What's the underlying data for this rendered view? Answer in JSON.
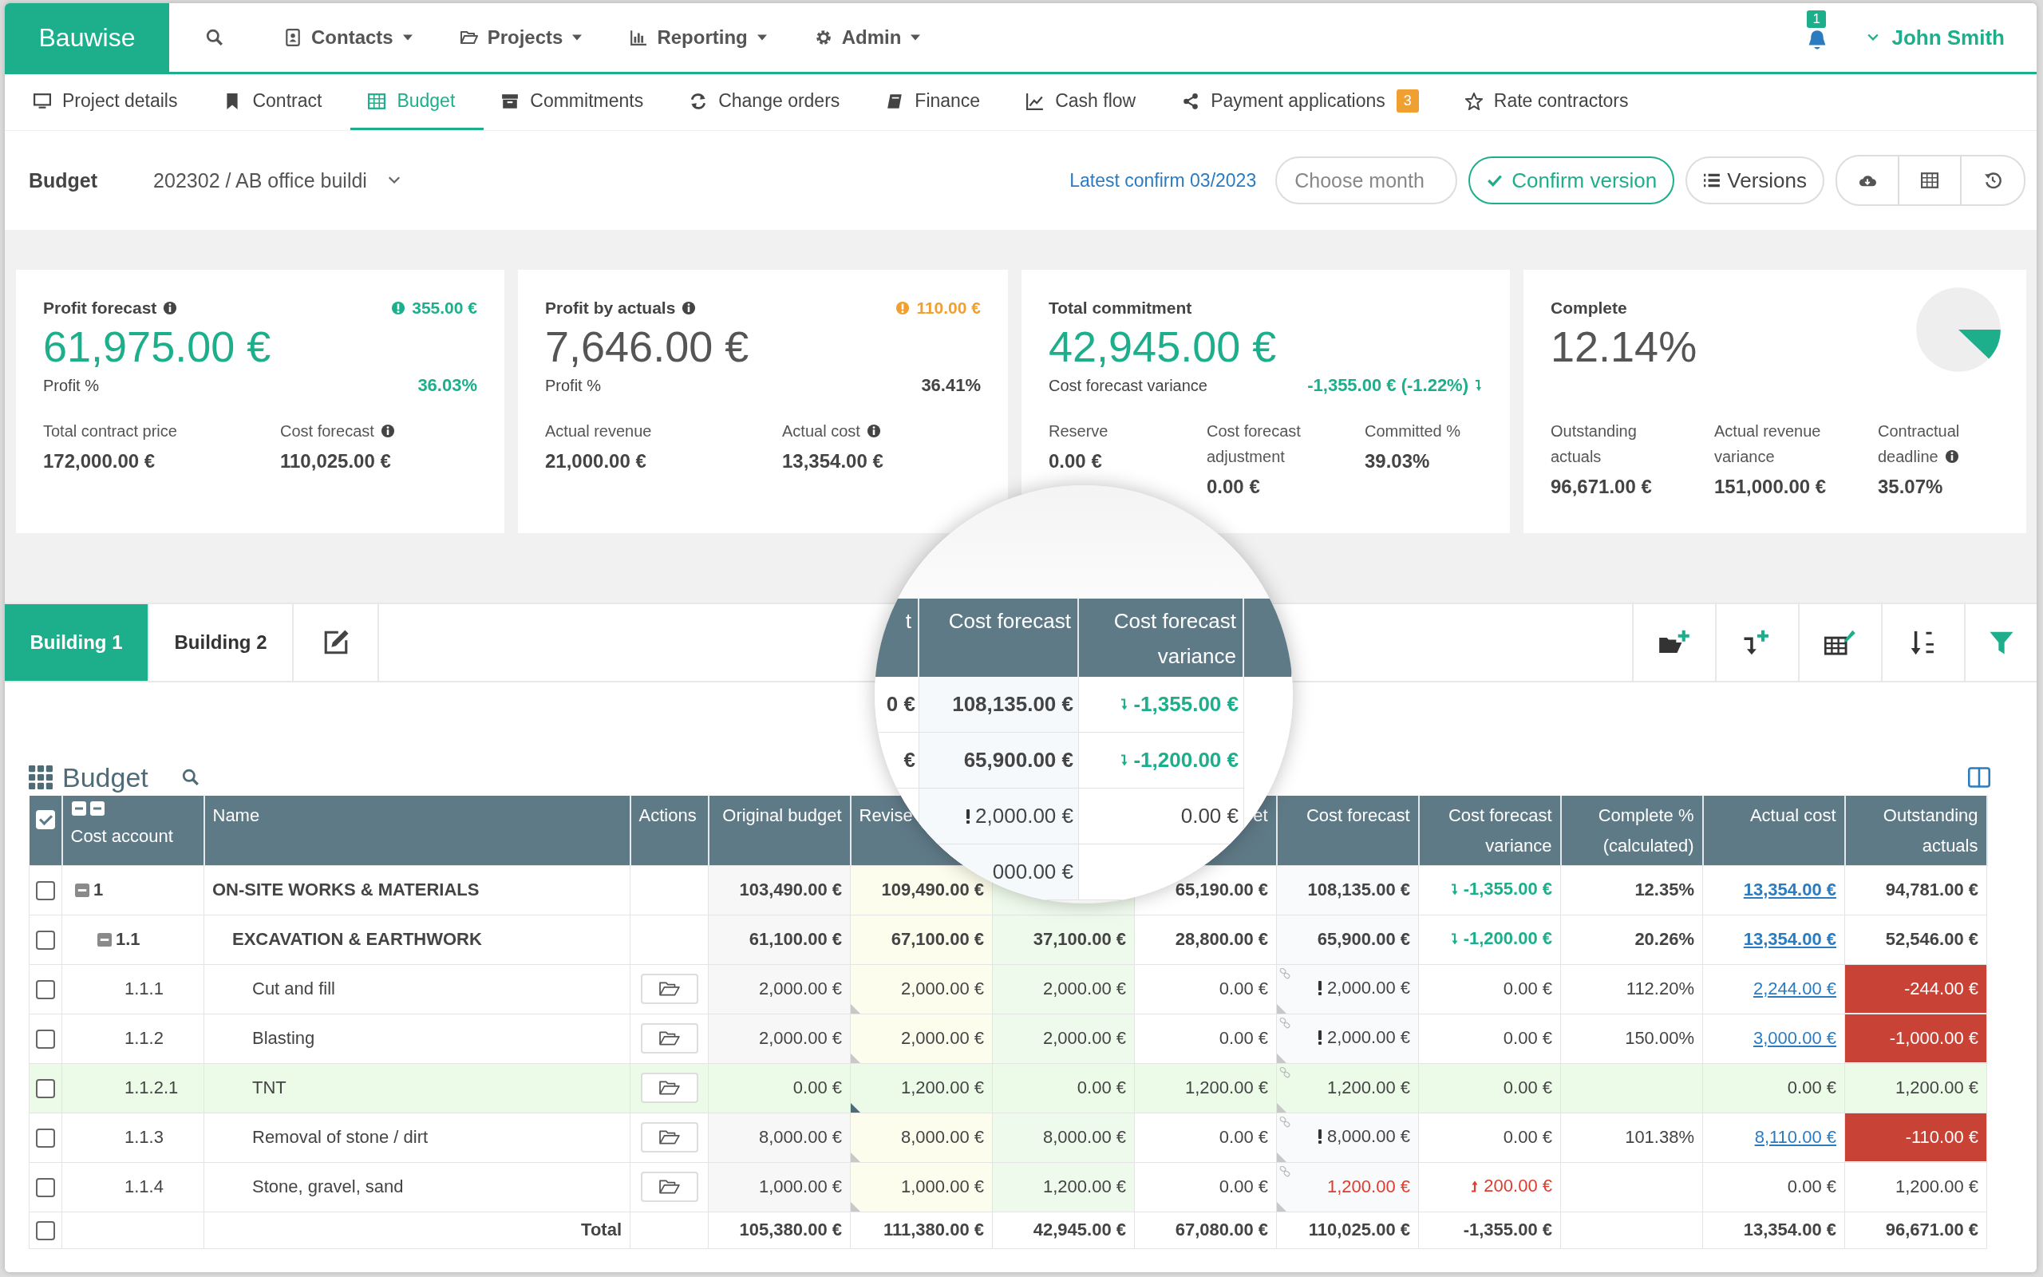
{
  "topnav": {
    "logo": "Bauwise",
    "items": [
      {
        "label": "Contacts"
      },
      {
        "label": "Projects"
      },
      {
        "label": "Reporting"
      },
      {
        "label": "Admin"
      }
    ],
    "notifications": "1",
    "user": "John Smith"
  },
  "tabs": [
    {
      "label": "Project details",
      "selected": false
    },
    {
      "label": "Contract",
      "selected": false
    },
    {
      "label": "Budget",
      "selected": true
    },
    {
      "label": "Commitments",
      "selected": false
    },
    {
      "label": "Change orders",
      "selected": false
    },
    {
      "label": "Finance",
      "selected": false
    },
    {
      "label": "Cash flow",
      "selected": false
    },
    {
      "label": "Payment applications",
      "selected": false,
      "badge": "3"
    },
    {
      "label": "Rate contractors",
      "selected": false
    }
  ],
  "toolbar": {
    "label": "Budget",
    "project": "202302 / AB office buildi",
    "latest_confirm": "Latest confirm 03/2023",
    "month_placeholder": "Choose month",
    "confirm_button": "Confirm version",
    "versions_button": "Versions"
  },
  "cards": [
    {
      "title": "Profit forecast",
      "info": true,
      "badge": "355.00 €",
      "color": "#1daf8c",
      "value": "61,975.00 €",
      "highlighted": true,
      "sub_label": "Profit %",
      "sub_value": "36.03%",
      "sub_highlighted": true,
      "metrics": [
        {
          "label": "Total contract price",
          "value": "172,000.00 €"
        },
        {
          "label": "Cost forecast",
          "info": true,
          "value": "110,025.00 €"
        }
      ]
    },
    {
      "title": "Profit by actuals",
      "info": true,
      "badge": "110.00 €",
      "color": "#f0a030",
      "value": "7,646.00 €",
      "highlighted": false,
      "sub_label": "Profit %",
      "sub_value": "36.41%",
      "sub_highlighted": false,
      "metrics": [
        {
          "label": "Actual revenue",
          "value": "21,000.00 €"
        },
        {
          "label": "Actual cost",
          "info": true,
          "value": "13,354.00 €"
        }
      ]
    },
    {
      "title": "Total commitment",
      "value": "42,945.00 €",
      "highlighted": true,
      "sub_label": "Cost forecast variance",
      "sub_value": "-1,355.00 € (-1.22%)",
      "sub_highlighted": true,
      "sub_decreasing": true,
      "metrics": [
        {
          "label": "Reserve",
          "value": "0.00 €"
        },
        {
          "label": "Cost forecast adjustment",
          "value": "0.00 €"
        },
        {
          "label": "Committed %",
          "value": "39.03%"
        }
      ]
    },
    {
      "title": "Complete",
      "value": "12.14%",
      "highlighted": false,
      "metrics": [
        {
          "label": "Outstanding actuals",
          "value": "96,671.00 €"
        },
        {
          "label": "Actual revenue variance",
          "value": "151,000.00 €"
        },
        {
          "label": "Contractual deadline",
          "info": true,
          "value": "35.07%"
        }
      ]
    }
  ],
  "buildings": [
    {
      "label": "Building 1",
      "selected": true
    },
    {
      "label": "Building 2",
      "selected": false
    }
  ],
  "table": {
    "title": "Budget",
    "headers": {
      "checked": true,
      "account": "Cost account",
      "name": "Name",
      "actions": "Actions",
      "original": "Original budget",
      "revised": "Revise",
      "column_4": "et",
      "forecast": "Cost forecast",
      "variance": "Cost forecast variance",
      "complete": "Complete % (calculated)",
      "actual": "Actual cost",
      "outstanding": "Outstanding actuals"
    },
    "rows": [
      {
        "account": "1",
        "name": "ON-SITE WORKS & MATERIALS",
        "kind": "group",
        "expanded": true,
        "checked": false,
        "original": "103,490.00 €",
        "revised": "109,490.00 €",
        "column_4": "65,190.00 €",
        "forecast": "108,135.00 €",
        "variance": "-1,355.00 €",
        "variance_decreased": true,
        "complete": "12.35%",
        "actual": "13,354.00 €",
        "actual_link": true,
        "outstanding": "94,781.00 €",
        "children": [
          {
            "account": "1.1",
            "name": "EXCAVATION & EARTHWORK",
            "kind": "group",
            "expanded": true,
            "checked": false,
            "original": "61,100.00 €",
            "revised": "67,100.00 €",
            "column_3": "37,100.00 €",
            "column_4": "28,800.00 €",
            "forecast": "65,900.00 €",
            "variance": "-1,200.00 €",
            "variance_decreased": true,
            "complete": "20.26%",
            "actual": "13,354.00 €",
            "actual_link": true,
            "outstanding": "52,546.00 €",
            "children": [
              {
                "account": "1.1.1",
                "name": "Cut and fill",
                "kind": "item",
                "checked": false,
                "original": "2,000.00 €",
                "revised": "2,000.00 €",
                "column_3": "2,000.00 €",
                "column_4": "0.00 €",
                "forecast": "2,000.00 €",
                "forecast_warning": true,
                "variance": "0.00 €",
                "complete": "112.20%",
                "actual": "2,244.00 €",
                "actual_link": true,
                "outstanding": "-244.00 €",
                "outstanding_negative": true
              },
              {
                "account": "1.1.2",
                "name": "Blasting",
                "kind": "item",
                "checked": false,
                "original": "2,000.00 €",
                "revised": "2,000.00 €",
                "column_3": "2,000.00 €",
                "column_4": "0.00 €",
                "forecast": "2,000.00 €",
                "forecast_warning": true,
                "variance": "0.00 €",
                "complete": "150.00%",
                "actual": "3,000.00 €",
                "actual_link": true,
                "outstanding": "-1,000.00 €",
                "outstanding_negative": true
              },
              {
                "account": "1.1.2.1",
                "name": "TNT",
                "kind": "item",
                "checked": false,
                "highlighted": true,
                "original": "0.00 €",
                "revised": "1,200.00 €",
                "column_3": "0.00 €",
                "column_4": "1,200.00 €",
                "forecast": "1,200.00 €",
                "variance": "0.00 €",
                "actual": "0.00 €",
                "actual_link": false,
                "outstanding": "1,200.00 €",
                "outstanding_negative": false
              },
              {
                "account": "1.1.3",
                "name": "Removal of stone / dirt",
                "kind": "item",
                "checked": false,
                "original": "8,000.00 €",
                "revised": "8,000.00 €",
                "column_3": "8,000.00 €",
                "column_4": "0.00 €",
                "forecast": "8,000.00 €",
                "forecast_warning": true,
                "variance": "0.00 €",
                "complete": "101.38%",
                "actual": "8,110.00 €",
                "actual_link": true,
                "outstanding": "-110.00 €",
                "outstanding_negative": true
              },
              {
                "account": "1.1.4",
                "name": "Stone, gravel, sand",
                "kind": "item",
                "checked": false,
                "original": "1,000.00 €",
                "revised": "1,000.00 €",
                "column_3": "1,200.00 €",
                "column_4": "0.00 €",
                "forecast": "1,200.00 €",
                "forecast_exceeded": true,
                "variance": "200.00 €",
                "variance_increased": true,
                "actual": "0.00 €",
                "actual_link": false,
                "outstanding": "1,200.00 €",
                "outstanding_negative": false
              }
            ]
          }
        ]
      }
    ],
    "total": {
      "label": "Total",
      "checked": false,
      "original": "105,380.00 €",
      "revised": "111,380.00 €",
      "column_3": "42,945.00 €",
      "column_4": "67,080.00 €",
      "forecast": "110,025.00 €",
      "variance": "-1,355.00 €",
      "actual": "13,354.00 €",
      "outstanding": "96,671.00 €"
    }
  },
  "magnifier": {
    "headers": [
      "t",
      "Cost forecast",
      "Cost forecast variance"
    ],
    "rows": [
      {
        "column_1": "0 €",
        "forecast": "108,135.00 €",
        "variance": "-1,355.00 €",
        "variance_decreased": true,
        "bold": true
      },
      {
        "column_1": "€",
        "forecast": "65,900.00 €",
        "variance": "-1,200.00 €",
        "variance_decreased": true,
        "bold": true
      },
      {
        "forecast": "2,000.00 €",
        "forecast_warning": true,
        "variance": "0.00 €",
        "bold": false
      },
      {
        "forecast": "000.00 €",
        "bold": false
      }
    ]
  }
}
